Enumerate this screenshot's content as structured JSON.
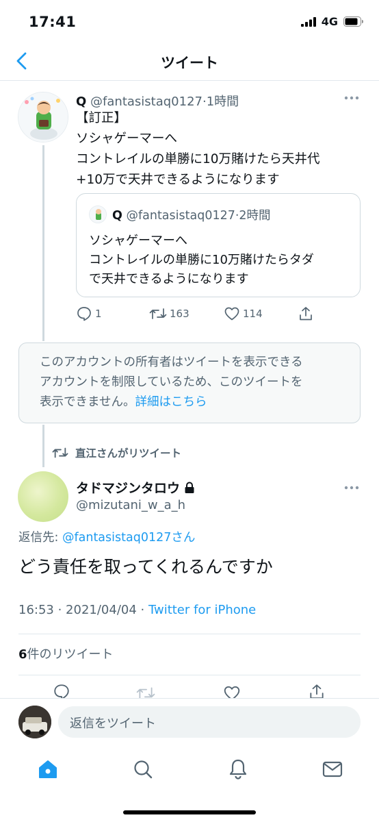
{
  "status_bar": {
    "time": "17:41",
    "network": "4G"
  },
  "nav": {
    "title": "ツイート"
  },
  "tweet1": {
    "name": "Q",
    "handle": "@fantasistaq0127",
    "time": "·1時間",
    "lines": [
      "【訂正】",
      "ソシャゲーマーへ",
      "コントレイルの単勝に10万賭けたら天井代",
      "+10万で天井できるようになります"
    ],
    "quote": {
      "name": "Q",
      "handle": "@fantasistaq0127",
      "time": "·2時間",
      "lines": [
        "ソシャゲーマーへ",
        "コントレイルの単勝に10万賭けたらタダ",
        "で天井できるようになります"
      ]
    },
    "actions": {
      "replies": "1",
      "retweets": "163",
      "likes": "114"
    }
  },
  "notice": {
    "lines": [
      "このアカウントの所有者はツイートを表示できる",
      "アカウントを制限しているため、このツイートを"
    ],
    "last_line": "表示できません。",
    "link": "詳細はこちら"
  },
  "retweet_label": "直江さんがリツイート",
  "main_tweet": {
    "name": "タドマジンタロウ",
    "handle": "@mizutani_w_a_h",
    "reply_prefix": "返信先: ",
    "reply_to": "@fantasistaq0127さん",
    "text": "どう責任を取ってくれるんですか",
    "date": "16:53 · 2021/04/04 · ",
    "source": "Twitter for iPhone",
    "retweet_count": "6",
    "retweet_label": "件のリツイート"
  },
  "reply_bar": {
    "placeholder": "返信をツイート"
  },
  "colors": {
    "accent": "#1d9bf0",
    "text": "#0f1419",
    "secondary": "#536471"
  }
}
